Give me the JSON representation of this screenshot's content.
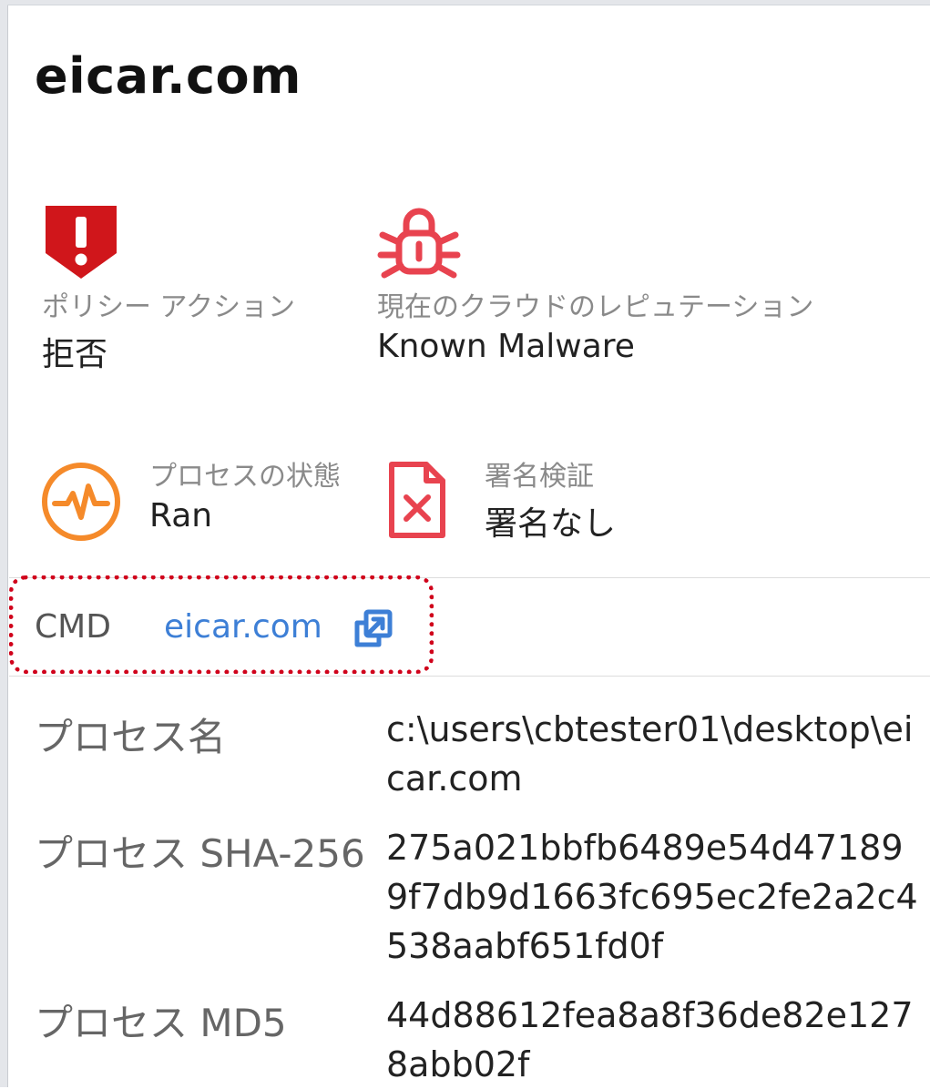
{
  "header": {
    "title": "eicar.com"
  },
  "summary": {
    "policy_action": {
      "label": "ポリシー アクション",
      "value": "拒否",
      "icon": "shield-alert-icon",
      "color": "#d0161b"
    },
    "cloud_reputation": {
      "label": "現在のクラウドのレピュテーション",
      "value": "Known Malware",
      "icon": "bug-lock-icon",
      "color": "#e8434f"
    },
    "process_state": {
      "label": "プロセスの状態",
      "value": "Ran",
      "icon": "activity-pulse-icon",
      "color": "#f58a2a"
    },
    "signature": {
      "label": "署名検証",
      "value": "署名なし",
      "icon": "file-x-icon",
      "color": "#e8434f"
    }
  },
  "cmd": {
    "label": "CMD",
    "link": "eicar.com",
    "icon": "external-link-icon",
    "link_color": "#3d7fd6",
    "highlight_color": "#d0021b"
  },
  "details": [
    {
      "label": "プロセス名",
      "value": "c:\\users\\cbtester01\\desktop\\eicar.com"
    },
    {
      "label": "プロセス SHA-256",
      "value": "275a021bbfb6489e54d471899f7db9d1663fc695ec2fe2a2c4538aabf651fd0f"
    },
    {
      "label": "プロセス MD5",
      "value": "44d88612fea8a8f36de82e1278abb02f"
    }
  ]
}
